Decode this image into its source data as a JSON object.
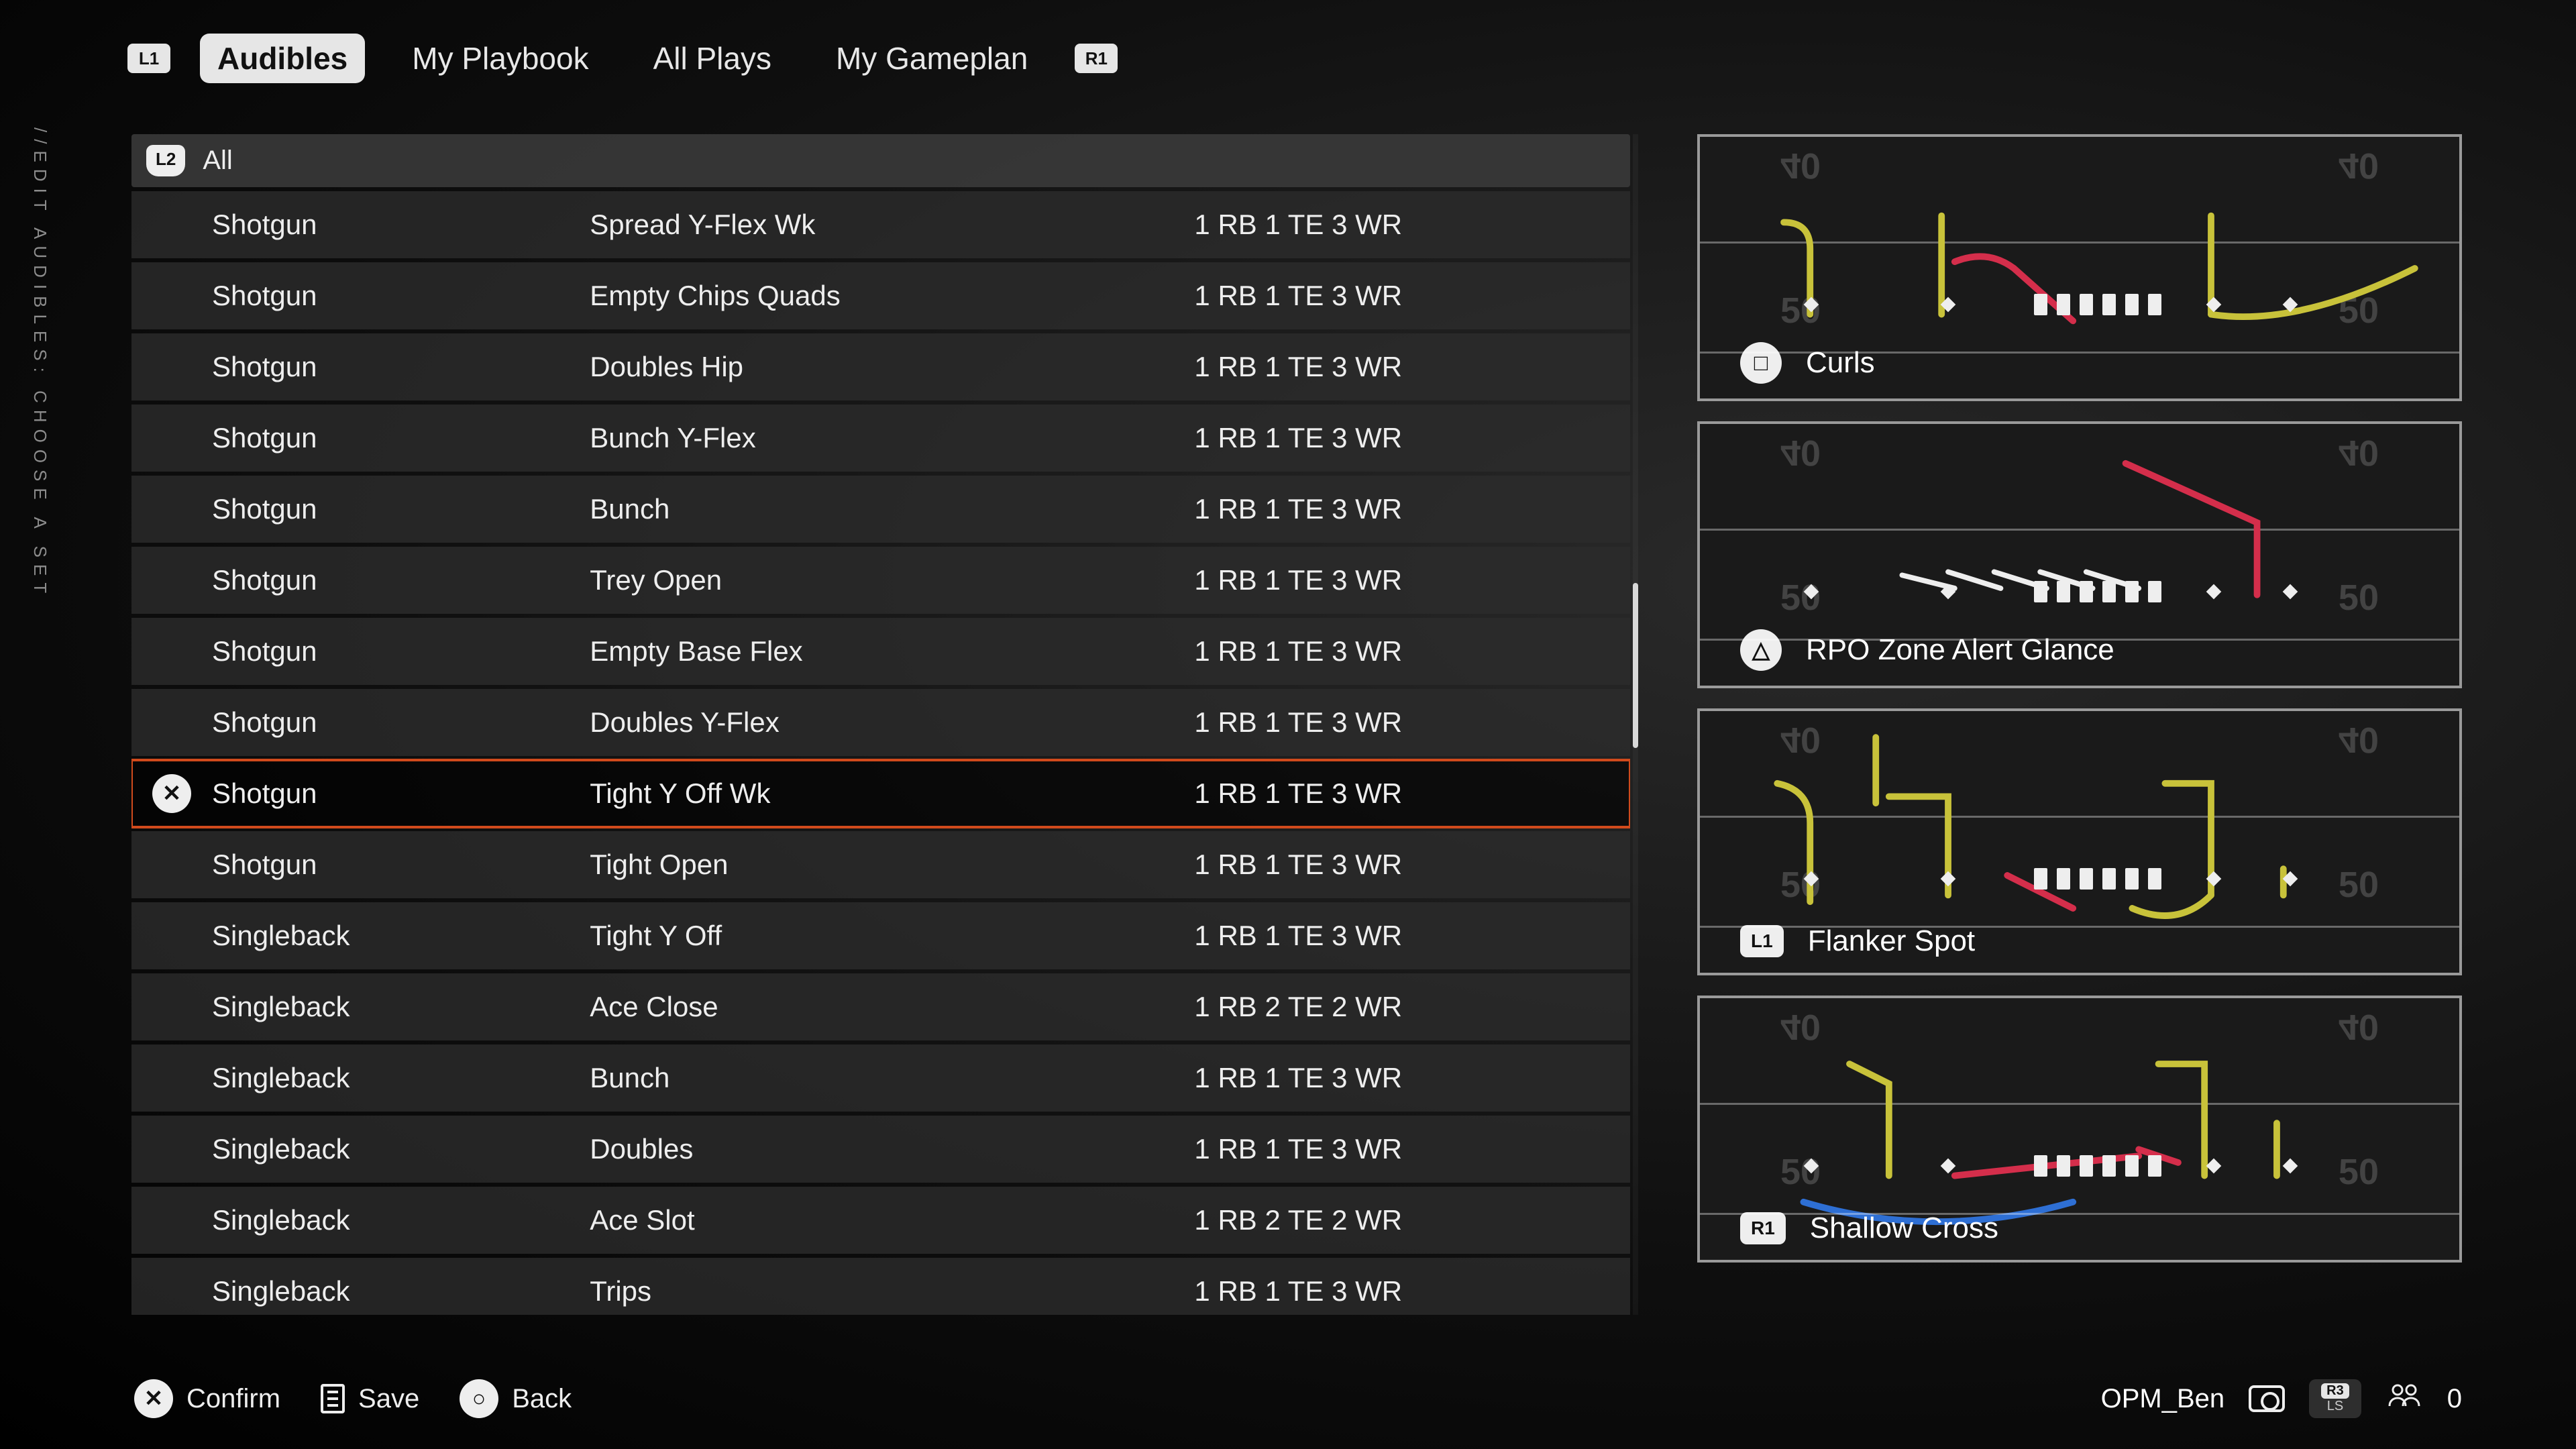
{
  "breadcrumb": "//EDIT AUDIBLES: CHOOSE A SET",
  "bumpers": {
    "left": "L1",
    "right": "R1"
  },
  "tabs": [
    {
      "label": "Audibles",
      "active": true
    },
    {
      "label": "My Playbook",
      "active": false
    },
    {
      "label": "All Plays",
      "active": false
    },
    {
      "label": "My Gameplan",
      "active": false
    }
  ],
  "filter": {
    "button": "L2",
    "label": "All"
  },
  "selected_index": 8,
  "formations": [
    {
      "set": "Shotgun",
      "name": "Spread Y-Flex Wk",
      "personnel": "1 RB 1 TE 3 WR"
    },
    {
      "set": "Shotgun",
      "name": "Empty Chips Quads",
      "personnel": "1 RB 1 TE 3 WR"
    },
    {
      "set": "Shotgun",
      "name": "Doubles Hip",
      "personnel": "1 RB 1 TE 3 WR"
    },
    {
      "set": "Shotgun",
      "name": "Bunch Y-Flex",
      "personnel": "1 RB 1 TE 3 WR"
    },
    {
      "set": "Shotgun",
      "name": "Bunch",
      "personnel": "1 RB 1 TE 3 WR"
    },
    {
      "set": "Shotgun",
      "name": "Trey Open",
      "personnel": "1 RB 1 TE 3 WR"
    },
    {
      "set": "Shotgun",
      "name": "Empty Base Flex",
      "personnel": "1 RB 1 TE 3 WR"
    },
    {
      "set": "Shotgun",
      "name": "Doubles Y-Flex",
      "personnel": "1 RB 1 TE 3 WR"
    },
    {
      "set": "Shotgun",
      "name": "Tight Y Off Wk",
      "personnel": "1 RB 1 TE 3 WR"
    },
    {
      "set": "Shotgun",
      "name": "Tight Open",
      "personnel": "1 RB 1 TE 3 WR"
    },
    {
      "set": "Singleback",
      "name": "Tight Y Off",
      "personnel": "1 RB 1 TE 3 WR"
    },
    {
      "set": "Singleback",
      "name": "Ace Close",
      "personnel": "1 RB 2 TE 2 WR"
    },
    {
      "set": "Singleback",
      "name": "Bunch",
      "personnel": "1 RB 1 TE 3 WR"
    },
    {
      "set": "Singleback",
      "name": "Doubles",
      "personnel": "1 RB 1 TE 3 WR"
    },
    {
      "set": "Singleback",
      "name": "Ace Slot",
      "personnel": "1 RB 2 TE 2 WR"
    },
    {
      "set": "Singleback",
      "name": "Trips",
      "personnel": "1 RB 1 TE 3 WR"
    }
  ],
  "plays": [
    {
      "button": "□",
      "button_shape": "circle",
      "name": "Curls",
      "yard_top": "40",
      "yard_bottom": "50"
    },
    {
      "button": "△",
      "button_shape": "circle",
      "name": "RPO Zone Alert Glance",
      "yard_top": "40",
      "yard_bottom": "50"
    },
    {
      "button": "L1",
      "button_shape": "pill",
      "name": "Flanker Spot",
      "yard_top": "40",
      "yard_bottom": "50"
    },
    {
      "button": "R1",
      "button_shape": "pill",
      "name": "Shallow Cross",
      "yard_top": "40",
      "yard_bottom": "50"
    }
  ],
  "footer": {
    "confirm": {
      "glyph": "✕",
      "label": "Confirm"
    },
    "save": {
      "label": "Save"
    },
    "back": {
      "glyph": "○",
      "label": "Back"
    }
  },
  "status": {
    "username": "OPM_Ben",
    "stick_top": "R3",
    "stick_bottom": "LS",
    "party_count": "0"
  },
  "colors": {
    "route_primary": "#c8c23a",
    "route_alert": "#d42e4b",
    "route_motion": "#2e6fd4",
    "selection": "#d04a1c"
  }
}
